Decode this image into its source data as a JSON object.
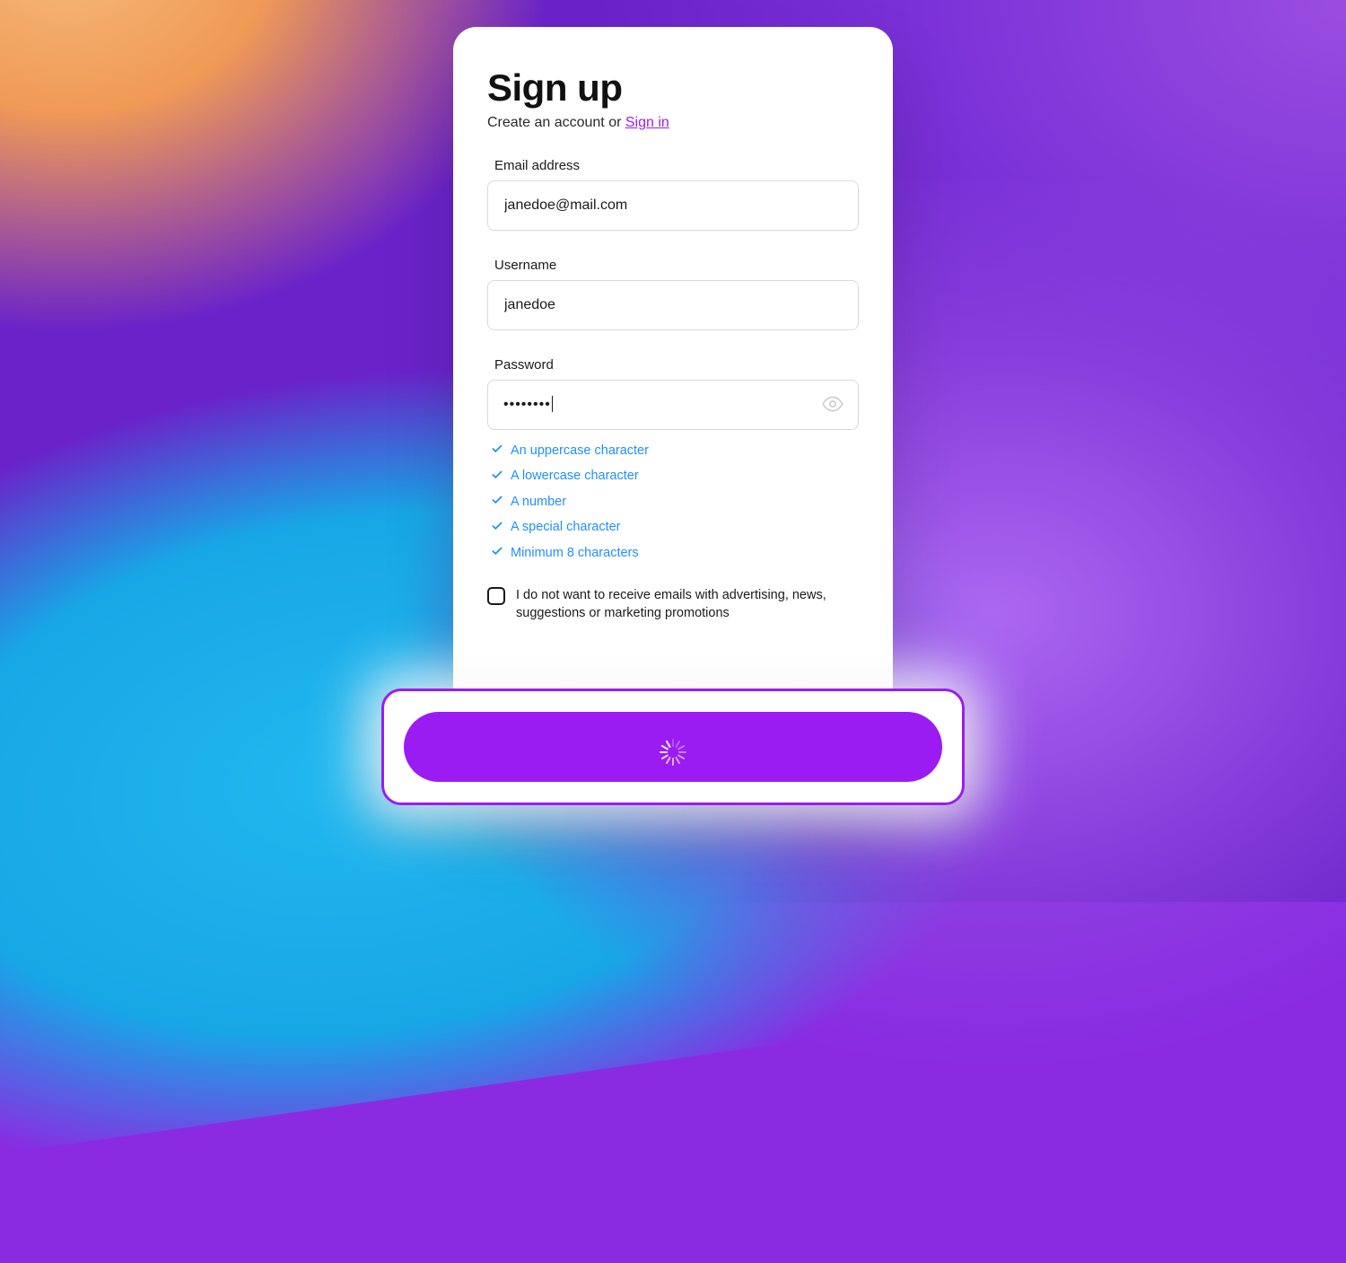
{
  "colors": {
    "accent": "#9b1cf2",
    "rule_ok": "#1e90ff"
  },
  "card": {
    "title": "Sign up",
    "subtitle_prefix": "Create an account or ",
    "signin_link": "Sign in",
    "email": {
      "label": "Email address",
      "value": "janedoe@mail.com"
    },
    "username": {
      "label": "Username",
      "value": "janedoe"
    },
    "password": {
      "label": "Password",
      "masked_value": "••••••••",
      "rules": [
        "An uppercase character",
        "A lowercase character",
        "A number",
        "A special character",
        "Minimum 8 characters"
      ]
    },
    "optout_text": "I do not want to receive emails with advertising, news, suggestions or marketing promotions",
    "optout_checked": false
  },
  "loading_button": {
    "state": "loading"
  }
}
